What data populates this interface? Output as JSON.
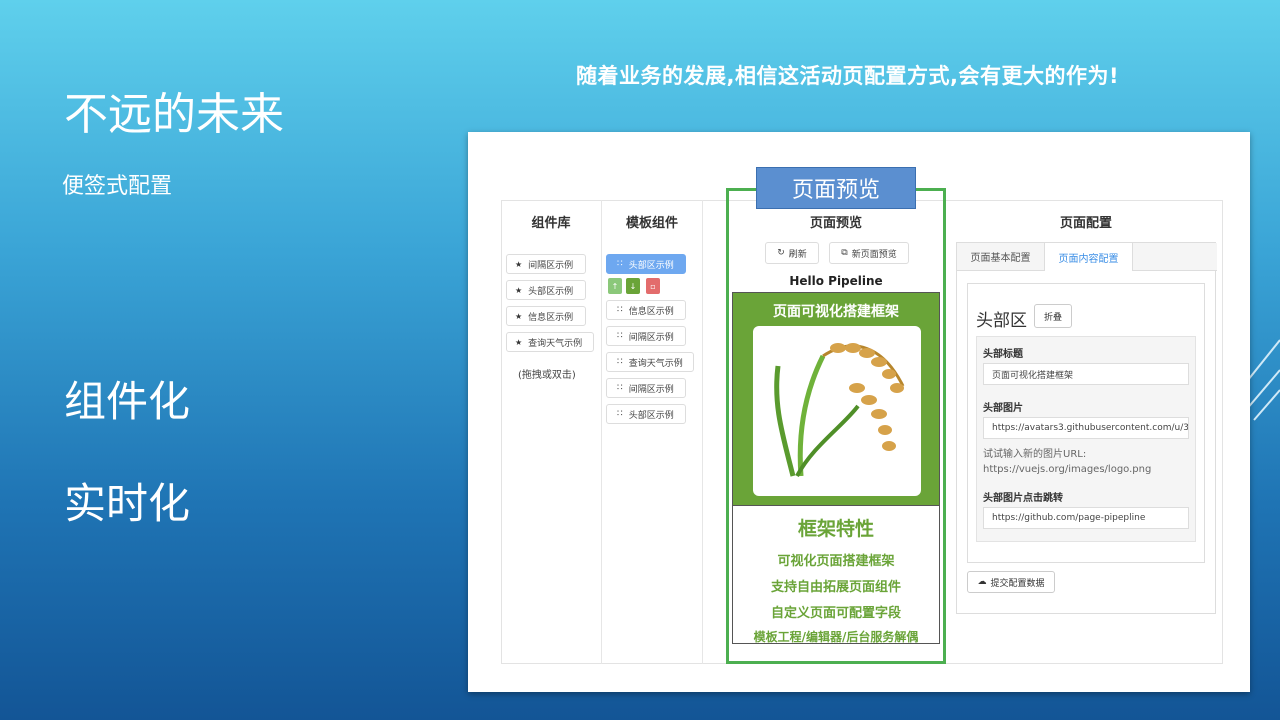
{
  "slide": {
    "title": "不远的未来",
    "subtitle": "便签式配置",
    "bullets": [
      "组件化",
      "实时化"
    ],
    "headline": "随着业务的发展,相信这活动页配置方式,会有更大的作为!"
  },
  "screenshot": {
    "columns": {
      "library": "组件库",
      "templates": "模板组件",
      "preview": "页面预览",
      "config": "页面配置"
    },
    "library_items": [
      "间隔区示例",
      "头部区示例",
      "信息区示例",
      "查询天气示例"
    ],
    "library_hint": "(拖拽或双击)",
    "template_items": [
      "头部区示例",
      "信息区示例",
      "间隔区示例",
      "查询天气示例",
      "间隔区示例",
      "头部区示例"
    ],
    "preview_tag": "页面预览",
    "preview_buttons": {
      "refresh": "刷新",
      "new_page": "新页面预览"
    },
    "preview_hello": "Hello Pipeline",
    "hero_title": "页面可视化搭建框架",
    "features_title": "框架特性",
    "features": [
      "可视化页面搭建框架",
      "支持自由拓展页面组件",
      "自定义页面可配置字段",
      "模板工程/编辑器/后台服务解偶"
    ],
    "config": {
      "tabs": [
        "页面基本配置",
        "页面内容配置"
      ],
      "section_title": "头部区",
      "fold_button": "折叠",
      "fields": [
        {
          "label": "头部标题",
          "value": "页面可视化搭建框架"
        },
        {
          "label": "头部图片",
          "value": "https://avatars3.githubusercontent.com/u/3"
        },
        {
          "label": "头部图片点击跳转",
          "value": "https://github.com/page-pipepline"
        }
      ],
      "hint_line1": "试试输入新的图片URL:",
      "hint_line2": "https://vuejs.org/images/logo.png",
      "submit": "提交配置数据"
    }
  },
  "colors": {
    "accent_green": "#6aa438",
    "active_blue": "#6ea8f0",
    "tag_blue": "#5b8fd0"
  }
}
